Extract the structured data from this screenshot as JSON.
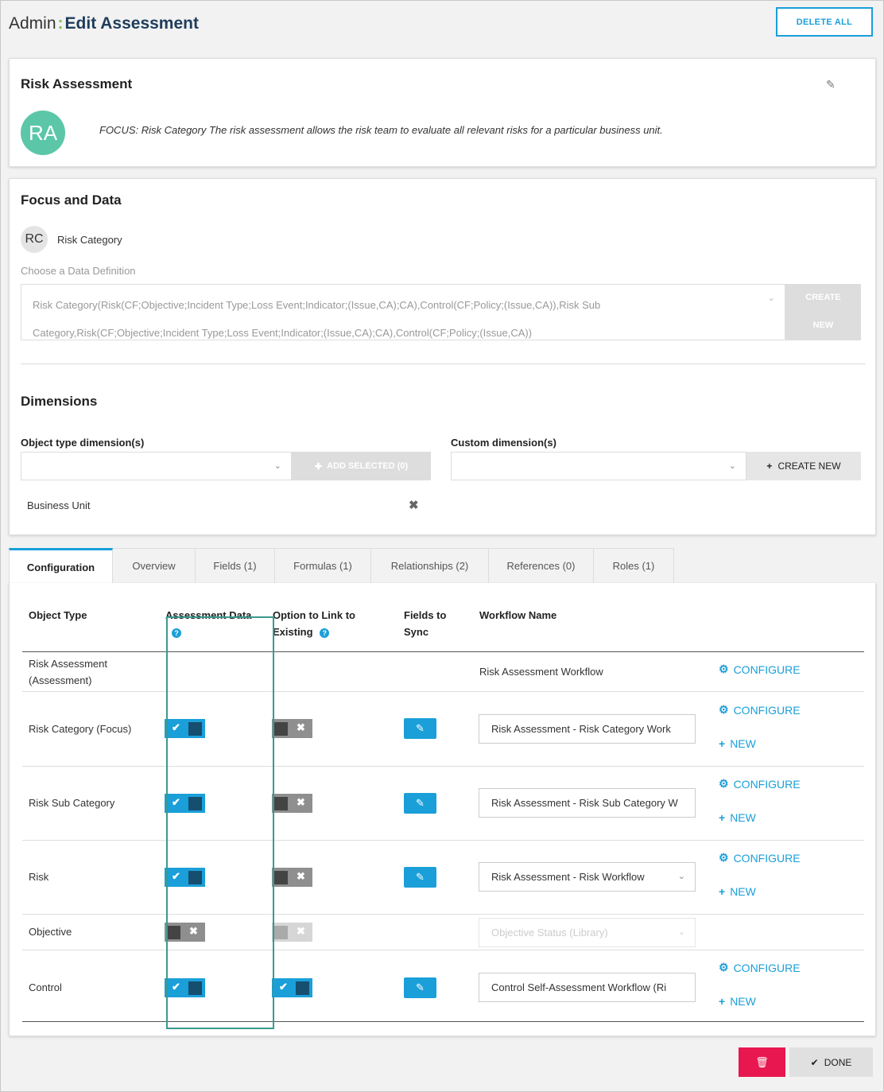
{
  "header": {
    "admin": "Admin",
    "separator": ":",
    "title": "Edit Assessment",
    "delete_all": "DELETE ALL"
  },
  "assessment": {
    "title": "Risk Assessment",
    "initials": "RA",
    "description": "FOCUS: Risk Category The risk assessment allows the risk team to evaluate all relevant risks for a particular business unit."
  },
  "focus": {
    "title": "Focus and Data",
    "initials": "RC",
    "name": "Risk Category",
    "data_def_label": "Choose a Data Definition",
    "data_def_line1": "Risk Category(Risk(CF;Objective;Incident Type;Loss Event;Indicator;(Issue,CA);CA),Control(CF;Policy;(Issue,CA)),Risk Sub",
    "data_def_line2": "Category,Risk(CF;Objective;Incident Type;Loss Event;Indicator;(Issue,CA);CA),Control(CF;Policy;(Issue,CA))",
    "create_line1": "CREATE",
    "create_line2": "NEW"
  },
  "dimensions": {
    "title": "Dimensions",
    "object_label": "Object type dimension(s)",
    "custom_label": "Custom dimension(s)",
    "add_selected": "ADD SELECTED (0)",
    "create_new": "CREATE NEW",
    "items": [
      "Business Unit"
    ]
  },
  "tabs": [
    "Configuration",
    "Overview",
    "Fields (1)",
    "Formulas (1)",
    "Relationships (2)",
    "References (0)",
    "Roles (1)"
  ],
  "table": {
    "headers": {
      "object_type": "Object Type",
      "assessment_data": "Assessment Data",
      "option_link_1": "Option to Link to",
      "option_link_2": "Existing",
      "fields_sync_1": "Fields to",
      "fields_sync_2": "Sync",
      "workflow": "Workflow Name"
    },
    "configure": "CONFIGURE",
    "new": "NEW",
    "rows": [
      {
        "name1": "Risk Assessment",
        "name2": "(Assessment)",
        "workflow_text": "Risk Assessment Workflow"
      },
      {
        "name": "Risk Category (Focus)",
        "assessment": "on",
        "link": "off",
        "workflow": "Risk Assessment - Risk Category Work"
      },
      {
        "name": "Risk Sub Category",
        "assessment": "on",
        "link": "off",
        "workflow": "Risk Assessment - Risk Sub Category W"
      },
      {
        "name": "Risk",
        "assessment": "on",
        "link": "off",
        "workflow": "Risk Assessment - Risk Workflow"
      },
      {
        "name": "Objective",
        "assessment": "off",
        "link": "disabled",
        "workflow": "Objective Status (Library)"
      },
      {
        "name": "Control",
        "assessment": "on",
        "link": "on",
        "workflow": "Control Self-Assessment Workflow (Ri"
      }
    ]
  },
  "footer": {
    "done": "DONE"
  },
  "colors": {
    "accent": "#1a9fd9",
    "danger": "#e8174f",
    "highlight": "#3a9a8e",
    "avatar_ra": "#5bc7a8"
  }
}
